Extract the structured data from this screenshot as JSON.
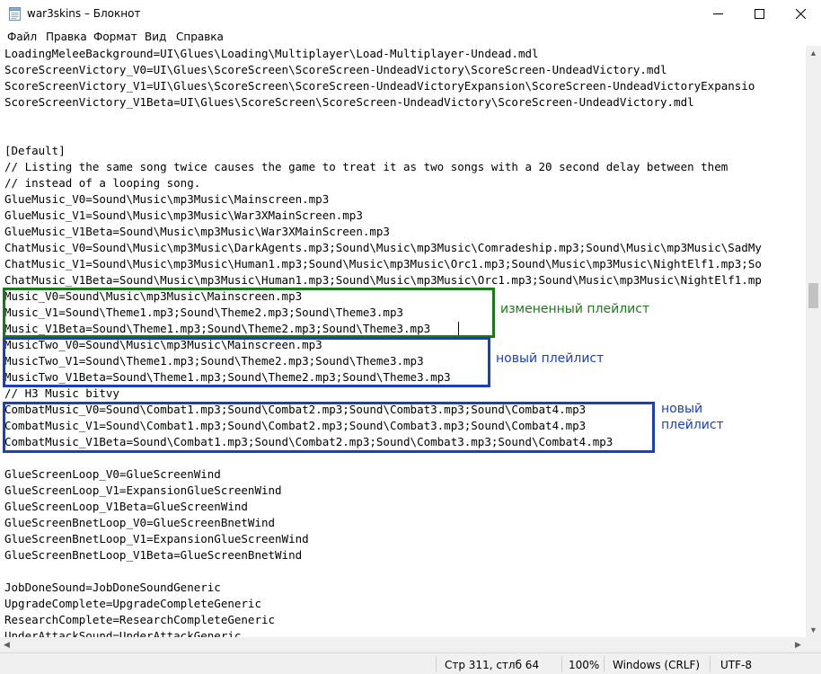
{
  "window": {
    "title": "war3skins – Блокнот",
    "icon": "notepad-icon",
    "controls": {
      "minimize": "minimize-icon",
      "maximize": "maximize-icon",
      "close": "close-icon"
    }
  },
  "menu": [
    "Файл",
    "Правка",
    "Формат",
    "Вид",
    "Справка"
  ],
  "editor": {
    "lines": [
      "LoadingMeleeBackground=UI\\Glues\\Loading\\Multiplayer\\Load-Multiplayer-Undead.mdl",
      "ScoreScreenVictory_V0=UI\\Glues\\ScoreScreen\\ScoreScreen-UndeadVictory\\ScoreScreen-UndeadVictory.mdl",
      "ScoreScreenVictory_V1=UI\\Glues\\ScoreScreen\\ScoreScreen-UndeadVictoryExpansion\\ScoreScreen-UndeadVictoryExpansio",
      "ScoreScreenVictory_V1Beta=UI\\Glues\\ScoreScreen\\ScoreScreen-UndeadVictory\\ScoreScreen-UndeadVictory.mdl",
      "",
      "",
      "[Default]",
      "// Listing the same song twice causes the game to treat it as two songs with a 20 second delay between them",
      "// instead of a looping song.",
      "GlueMusic_V0=Sound\\Music\\mp3Music\\Mainscreen.mp3",
      "GlueMusic_V1=Sound\\Music\\mp3Music\\War3XMainScreen.mp3",
      "GlueMusic_V1Beta=Sound\\Music\\mp3Music\\War3XMainScreen.mp3",
      "ChatMusic_V0=Sound\\Music\\mp3Music\\DarkAgents.mp3;Sound\\Music\\mp3Music\\Comradeship.mp3;Sound\\Music\\mp3Music\\SadMy",
      "ChatMusic_V1=Sound\\Music\\mp3Music\\Human1.mp3;Sound\\Music\\mp3Music\\Orc1.mp3;Sound\\Music\\mp3Music\\NightElf1.mp3;So",
      "ChatMusic_V1Beta=Sound\\Music\\mp3Music\\Human1.mp3;Sound\\Music\\mp3Music\\Orc1.mp3;Sound\\Music\\mp3Music\\NightElf1.mp",
      "Music_V0=Sound\\Music\\mp3Music\\Mainscreen.mp3",
      "Music_V1=Sound\\Theme1.mp3;Sound\\Theme2.mp3;Sound\\Theme3.mp3",
      "Music_V1Beta=Sound\\Theme1.mp3;Sound\\Theme2.mp3;Sound\\Theme3.mp3",
      "MusicTwo_V0=Sound\\Music\\mp3Music\\Mainscreen.mp3",
      "MusicTwo_V1=Sound\\Theme1.mp3;Sound\\Theme2.mp3;Sound\\Theme3.mp3",
      "MusicTwo_V1Beta=Sound\\Theme1.mp3;Sound\\Theme2.mp3;Sound\\Theme3.mp3",
      "// H3 Music bitvy",
      "CombatMusic_V0=Sound\\Combat1.mp3;Sound\\Combat2.mp3;Sound\\Combat3.mp3;Sound\\Combat4.mp3",
      "CombatMusic_V1=Sound\\Combat1.mp3;Sound\\Combat2.mp3;Sound\\Combat3.mp3;Sound\\Combat4.mp3",
      "CombatMusic_V1Beta=Sound\\Combat1.mp3;Sound\\Combat2.mp3;Sound\\Combat3.mp3;Sound\\Combat4.mp3",
      "",
      "GlueScreenLoop_V0=GlueScreenWind",
      "GlueScreenLoop_V1=ExpansionGlueScreenWind",
      "GlueScreenLoop_V1Beta=GlueScreenWind",
      "GlueScreenBnetLoop_V0=GlueScreenBnetWind",
      "GlueScreenBnetLoop_V1=ExpansionGlueScreenWind",
      "GlueScreenBnetLoop_V1Beta=GlueScreenBnetWind",
      "",
      "JobDoneSound=JobDoneSoundGeneric",
      "UpgradeComplete=UpgradeCompleteGeneric",
      "ResearchComplete=ResearchCompleteGeneric",
      "UnderAttackSound=UnderAttackGeneric"
    ]
  },
  "annotations": {
    "changed_playlist": {
      "text": "измененный плейлист",
      "color": "#1a7a1a"
    },
    "new_playlist_1": {
      "text": "новый плейлист",
      "color": "#1a3fc4"
    },
    "new_playlist_2": {
      "line1": "новый",
      "line2": "плейлист",
      "color": "#1a3fc4"
    }
  },
  "status": {
    "position": "Стр 311, стлб 64",
    "zoom": "100%",
    "line_endings": "Windows (CRLF)",
    "encoding": "UTF-8"
  }
}
